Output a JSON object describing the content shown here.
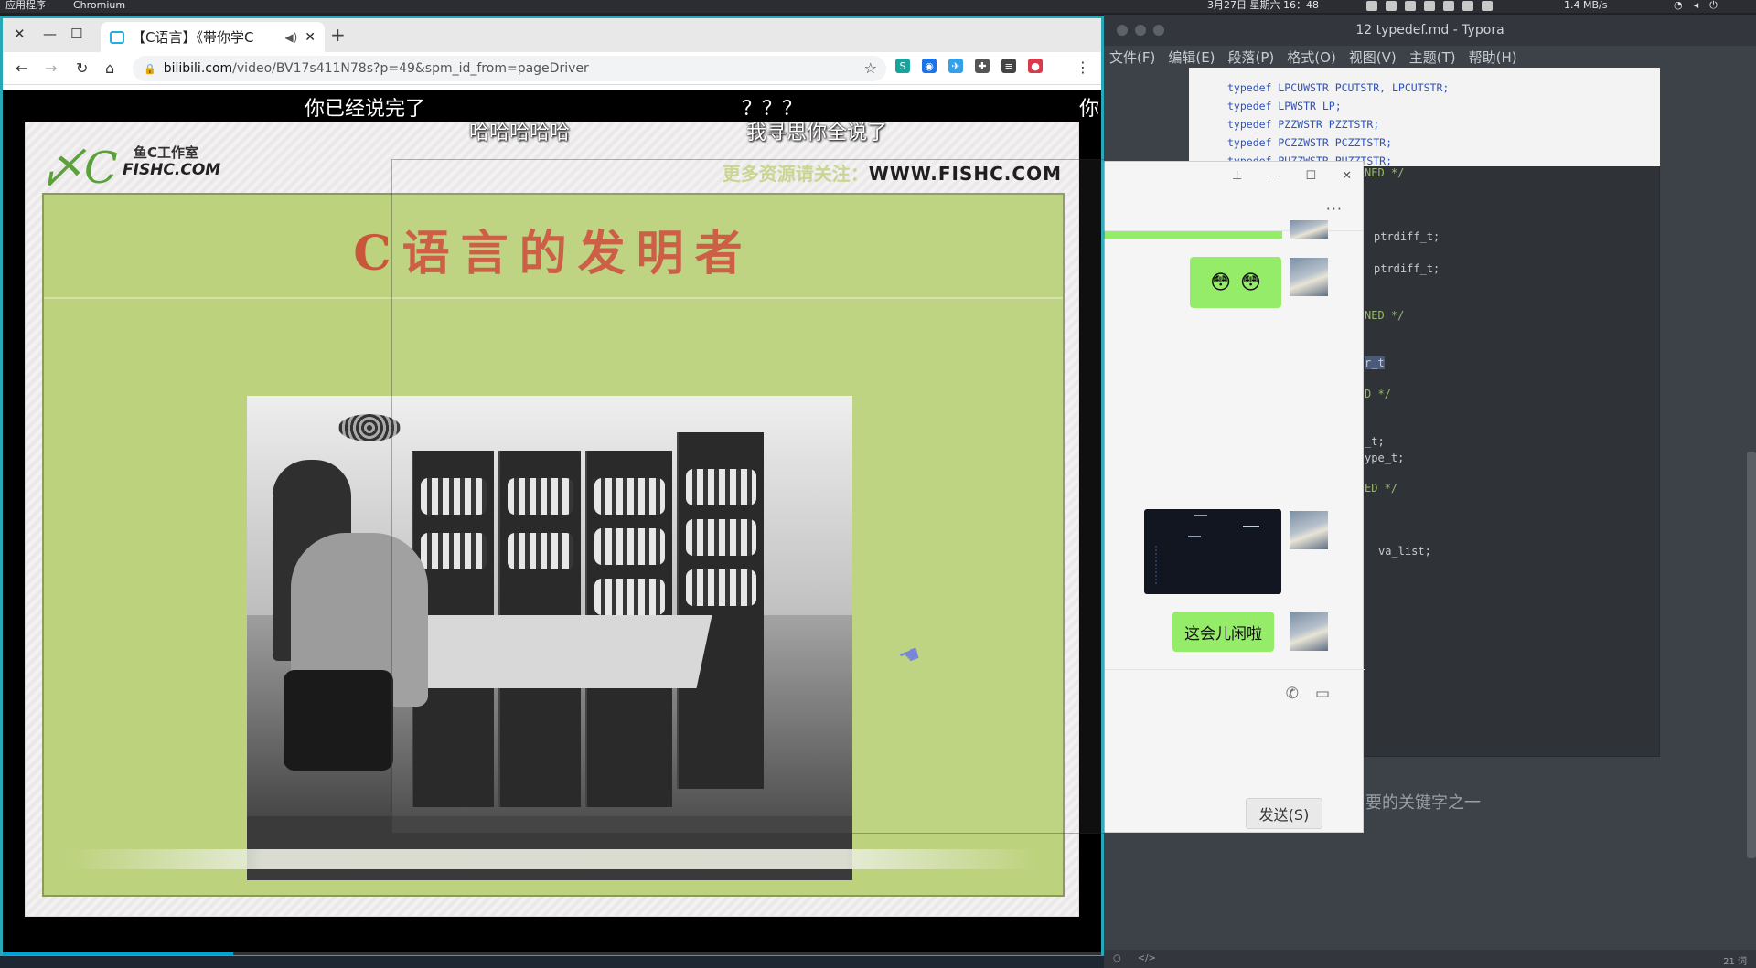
{
  "panel": {
    "apps_label": "应用程序",
    "active_app": "Chromium",
    "datetime": "3月27日 星期六 16：48",
    "net_speed": "1.4 MB/s"
  },
  "typora": {
    "title": "12 typedef.md - Typora",
    "menu": [
      "文件(F)",
      "编辑(E)",
      "段落(P)",
      "格式(O)",
      "视图(V)",
      "主题(T)",
      "帮助(H)"
    ],
    "code_top": [
      "typedef LPCUWSTR PCUTSTR, LPCUTSTR;",
      "typedef LPWSTR LP;",
      "typedef PZZWSTR PZZTSTR;",
      "typedef PCZZWSTR PCZZTSTR;",
      "typedef PUZZWSTR PUZZTSTR;"
    ],
    "code_fragments": {
      "c1": "NED */",
      "p1": "ptrdiff_t;",
      "p2": "ptrdiff_t;",
      "c2": "NED */",
      "sel": "r_t",
      "c3": "D */",
      "t1": "_t;",
      "t2": "ype_t;",
      "c4": "ED */",
      "va": "va_list;"
    },
    "paragraph_tail": "要的关键字之一",
    "word_count": "21 词"
  },
  "chat": {
    "emoji": [
      "😳",
      "😳"
    ],
    "message": "这会儿闲啦",
    "send_label": "发送(S)"
  },
  "browser": {
    "tab_title": "【C语言】《带你学C",
    "url_host": "bilibili.com",
    "url_path": "/video/BV17s411N78s?p=49&spm_id_from=pageDriver",
    "extension_colors": [
      "#1aa39a",
      "#1a73e8",
      "#35a0e8",
      "#555555",
      "#444444",
      "#d93b4c"
    ]
  },
  "video": {
    "danmaku": [
      "你已经说完了",
      "哈哈哈哈哈",
      "？？？",
      "我寻思你全说了",
      "你"
    ],
    "slide": {
      "logo_studio": "鱼C工作室",
      "logo_domain": "FISHC.COM",
      "promo_text": "更多资源请关注：",
      "promo_url": "WWW.FISHC.COM",
      "heading": "C语言的发明者"
    },
    "progress_fraction": 0.21
  }
}
